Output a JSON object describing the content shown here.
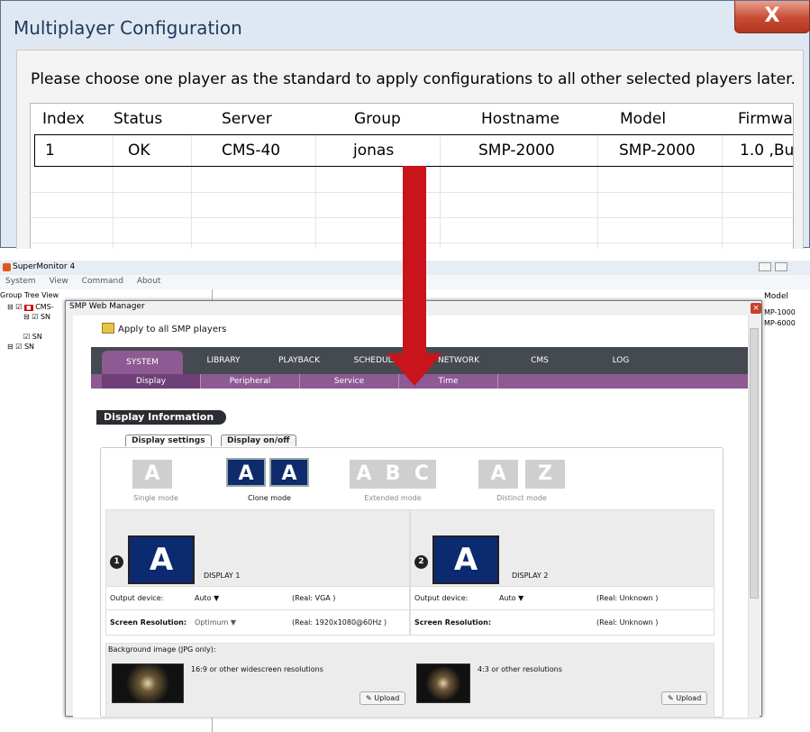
{
  "mp_dialog": {
    "title": "Multiplayer Configuration",
    "close_label": "X",
    "instruction": "Please choose one player as the standard to apply configurations to all other selected players later.",
    "columns": [
      "Index",
      "Status",
      "Server",
      "Group",
      "Hostname",
      "Model",
      "Firmwar"
    ],
    "rows": [
      [
        "1",
        "OK",
        "CMS-40",
        "jonas",
        "SMP-2000",
        "SMP-2000",
        "1.0 ,Bu"
      ]
    ]
  },
  "supermonitor": {
    "title": "SuperMonitor 4",
    "menu": [
      "System",
      "View",
      "Command",
      "About"
    ],
    "group_tree_label": "Group Tree View",
    "tree": [
      "CMS-",
      "SN",
      "SN",
      "SN"
    ],
    "grid_header": "Model",
    "grid_values": [
      "MP-1000",
      "MP-6000"
    ]
  },
  "web_manager": {
    "title": "SMP Web Manager",
    "apply_label": "Apply to all SMP players",
    "tabs": [
      "SYSTEM",
      "LIBRARY",
      "PLAYBACK",
      "SCHEDULE",
      "NETWORK",
      "CMS",
      "LOG"
    ],
    "subtabs": [
      "Display",
      "Peripheral",
      "Service",
      "Time"
    ],
    "section_title": "Display Information",
    "display_tabs": [
      "Display settings",
      "Display on/off"
    ],
    "modes": [
      {
        "label": "Single mode",
        "letters": [
          "A"
        ]
      },
      {
        "label": "Clone mode",
        "letters": [
          "A",
          "A"
        ]
      },
      {
        "label": "Extended mode",
        "letters": [
          "A",
          "B",
          "C"
        ]
      },
      {
        "label": "Distinct mode",
        "letters": [
          "A",
          "Z"
        ]
      }
    ],
    "display1": {
      "num": "1",
      "name": "DISPLAY 1",
      "letter": "A",
      "output_label": "Output device:",
      "output_value": "Auto ▼",
      "output_real": "(Real: VGA )",
      "res_label": "Screen Resolution:",
      "res_value": "Optimum ▼",
      "res_real": "(Real: 1920x1080@60Hz )"
    },
    "display2": {
      "num": "2",
      "name": "DISPLAY 2",
      "letter": "A",
      "output_label": "Output device:",
      "output_value": "Auto ▼",
      "output_real": "(Real: Unknown )",
      "res_label": "Screen Resolution:",
      "res_real": "(Real: Unknown )"
    },
    "bg_label": "Background image (JPG only):",
    "bg1_label": "16:9 or other widescreen resolutions",
    "bg2_label": "4:3 or other resolutions",
    "upload_label": "Upload"
  },
  "colors": {
    "accent": "#8d5a93",
    "arrow": "#c8141a"
  }
}
